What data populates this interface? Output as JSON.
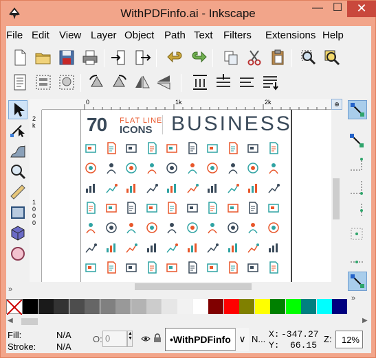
{
  "window": {
    "title": "WithPDFinfo.ai - Inkscape",
    "minimize": "—",
    "maximize": "☐",
    "close": "✕"
  },
  "menu": [
    "File",
    "Edit",
    "View",
    "Layer",
    "Object",
    "Path",
    "Text",
    "Filters",
    "Extensions",
    "Help"
  ],
  "menu_mnemonics": [
    "F",
    "E",
    "V",
    "L",
    "O",
    "P",
    "T",
    "",
    "E",
    "H"
  ],
  "toolbar_commands": [
    "new-document",
    "open",
    "save",
    "print",
    "import",
    "export",
    "undo",
    "redo",
    "copy",
    "cut",
    "paste",
    "zoom-selection",
    "zoom-drawing"
  ],
  "toolbar_snap": [
    "document-properties",
    "group",
    "ungroup",
    "fill-stroke",
    "align-top",
    "align-center",
    "flip-horizontal",
    "flip-vertical",
    "distribute-top",
    "distribute-center",
    "distribute-bottom",
    "raise-top"
  ],
  "tools": [
    "selector",
    "node",
    "tweak",
    "zoom",
    "measure",
    "rectangle",
    "3d-box",
    "ellipse"
  ],
  "snap_tools": [
    "snap-enable",
    "snap-bbox",
    "snap-edge",
    "snap-corner",
    "snap-midpoint",
    "snap-center",
    "snap-nodes",
    "snap-path",
    "snap-page"
  ],
  "rulers": {
    "h_labels": [
      "0",
      "1k",
      "2k"
    ],
    "v_label_1": "2",
    "v_label_2": "k",
    "v_label_3": "1",
    "v_label_4": "0",
    "v_label_5": "0",
    "v_label_6": "0"
  },
  "artwork": {
    "count": "70",
    "line1": "FLAT LINE",
    "line2": "ICONS",
    "heading": "BUSINESS",
    "accent": "#e8562a",
    "teal": "#2fa3a3",
    "dark": "#3a4a5a"
  },
  "palette": [
    "none",
    "#000000",
    "#1a1a1a",
    "#333333",
    "#4d4d4d",
    "#666666",
    "#808080",
    "#999999",
    "#b3b3b3",
    "#cccccc",
    "#e6e6e6",
    "#f2f2f2",
    "#ffffff",
    "#800000",
    "#ff0000",
    "#808000",
    "#ffff00",
    "#008000",
    "#00ff00",
    "#008080",
    "#00ffff",
    "#000080"
  ],
  "status": {
    "fill_label": "Fill:",
    "fill_value": "N/A",
    "stroke_label": "Stroke:",
    "stroke_value": "N/A",
    "opacity_label": "O:",
    "opacity_value": "0",
    "layer_name": "•WithPDFinfo",
    "layer_dropdown": "∨",
    "notice": "N...",
    "x_label": "X:",
    "x_value": "-347.27",
    "y_label": "Y:",
    "y_value": "66.15",
    "zoom_label": "Z:",
    "zoom_value": "12%"
  }
}
